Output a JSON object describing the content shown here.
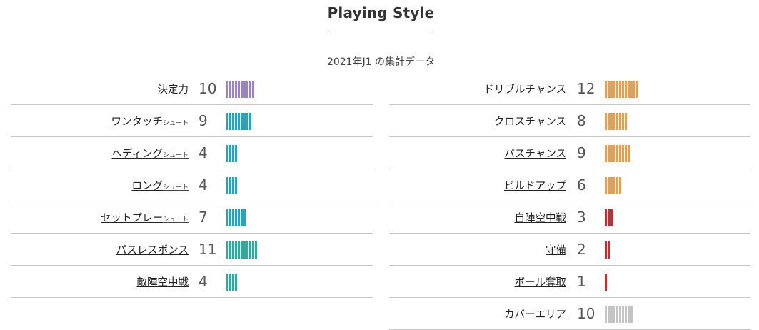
{
  "header": {
    "title": "Playing Style",
    "subtitle": "2021年J1 の集計データ"
  },
  "colors": {
    "purple": "#9b7fd4",
    "blue": "#1ba6cf",
    "teal": "#21b39a",
    "orange": "#f39a4a",
    "red": "#d6262b",
    "gray": "#c4c4c4"
  },
  "left_stats": [
    {
      "label": "決定力",
      "suffix": "",
      "value": "10",
      "count": 10,
      "color": "purple"
    },
    {
      "label": "ワンタッチ",
      "suffix": "シュート",
      "value": "9",
      "count": 9,
      "color": "blue"
    },
    {
      "label": "ヘディング",
      "suffix": "シュート",
      "value": "4",
      "count": 4,
      "color": "blue"
    },
    {
      "label": "ロング",
      "suffix": "シュート",
      "value": "4",
      "count": 4,
      "color": "blue"
    },
    {
      "label": "セットプレー",
      "suffix": "シュート",
      "value": "7",
      "count": 7,
      "color": "blue"
    },
    {
      "label": "パスレスポンス",
      "suffix": "",
      "value": "11",
      "count": 11,
      "color": "teal"
    },
    {
      "label": "敵陣空中戦",
      "suffix": "",
      "value": "4",
      "count": 4,
      "color": "teal"
    }
  ],
  "right_stats": [
    {
      "label": "ドリブルチャンス",
      "suffix": "",
      "value": "12",
      "count": 12,
      "color": "orange"
    },
    {
      "label": "クロスチャンス",
      "suffix": "",
      "value": "8",
      "count": 8,
      "color": "orange"
    },
    {
      "label": "パスチャンス",
      "suffix": "",
      "value": "9",
      "count": 9,
      "color": "orange"
    },
    {
      "label": "ビルドアップ",
      "suffix": "",
      "value": "6",
      "count": 6,
      "color": "orange"
    },
    {
      "label": "自陣空中戦",
      "suffix": "",
      "value": "3",
      "count": 3,
      "color": "red"
    },
    {
      "label": "守備",
      "suffix": "",
      "value": "2",
      "count": 2,
      "color": "red"
    },
    {
      "label": "ボール奪取",
      "suffix": "",
      "value": "1",
      "count": 1,
      "color": "red"
    },
    {
      "label": "カバーエリア",
      "suffix": "",
      "value": "10",
      "count": 10,
      "color": "gray"
    }
  ]
}
